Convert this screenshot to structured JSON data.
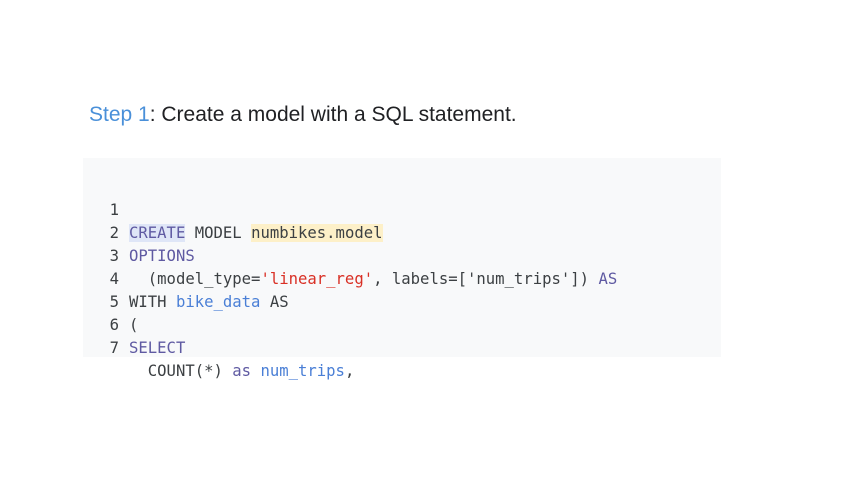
{
  "heading": {
    "step_label": "Step 1",
    "text": ": Create a model with a SQL statement."
  },
  "code": {
    "lines": [
      {
        "num": "1",
        "t0": "CREATE",
        "t1": " MODEL ",
        "t2": "numbikes.model"
      },
      {
        "num": "2",
        "t0": "OPTIONS"
      },
      {
        "num": "3",
        "t0": "  (model_type=",
        "t1": "'linear_reg'",
        "t2": ", labels=['num_trips']) ",
        "t3": "AS"
      },
      {
        "num": "4",
        "t0": "WITH ",
        "t1": "bike_data",
        "t2": " ",
        "t3": "AS"
      },
      {
        "num": "5",
        "t0": "("
      },
      {
        "num": "6",
        "t0": "SELECT"
      },
      {
        "num": "7",
        "t0": "  COUNT(*) ",
        "t1": "as",
        "t2": " ",
        "t3": "num_trips",
        "t4": ","
      }
    ]
  },
  "colors": {
    "step_label": "#4a90d9",
    "keyword": "#5f5aa2",
    "identifier": "#4a7fd6",
    "string": "#d93025",
    "highlight_blue": "#dfe6f7",
    "highlight_yellow": "#fdf0c8",
    "code_background": "#f8f9fa"
  }
}
